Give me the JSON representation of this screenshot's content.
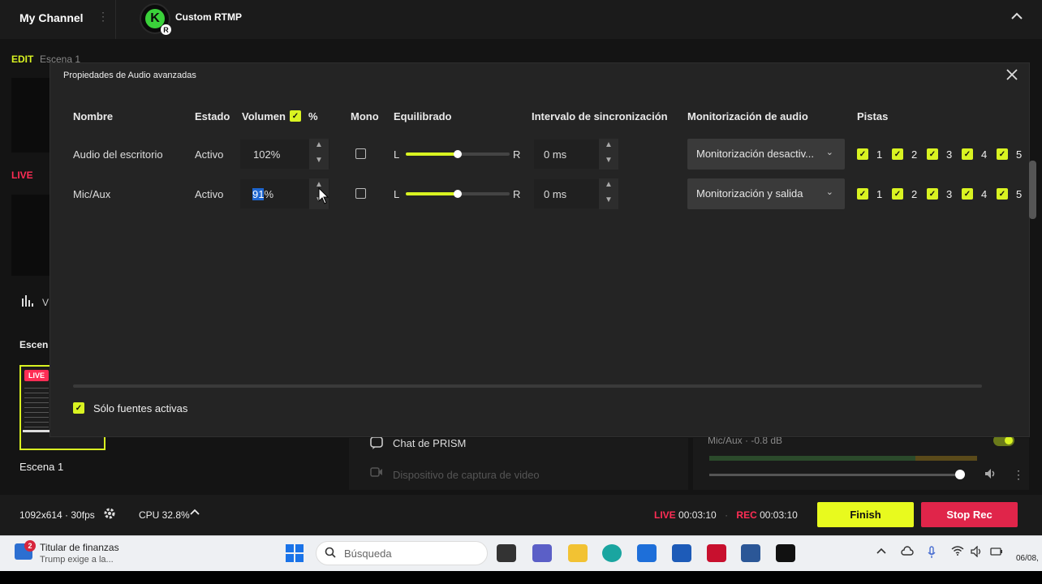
{
  "topbar": {
    "channel": "My Channel",
    "kebab": "⋮",
    "rtmp": "Custom RTMP",
    "collapse": "^",
    "logo_k": "K",
    "logo_r": "R"
  },
  "background": {
    "edit_label": "EDIT",
    "edit_scene": "Escena 1",
    "live_label": "LIVE",
    "bars_text": "V",
    "escenas_head": "Escen",
    "scene_tag": "LIVE",
    "scene_name": "Escena 1",
    "chat_text": "Chat de PRISM",
    "camera_text": "Dispositivo de captura de video",
    "mic_row": "Mic/Aux · -0.8 dB"
  },
  "statusbar": {
    "resolution": "1092x614 · 30fps",
    "cpu": "CPU 32.8%",
    "live_label": "LIVE",
    "live_time": "00:03:10",
    "rec_label": "REC",
    "rec_time": "00:03:10",
    "finish": "Finish",
    "stop_rec": "Stop Rec"
  },
  "dialog": {
    "title": "Propiedades de Audio avanzadas",
    "headers": {
      "name": "Nombre",
      "state": "Estado",
      "volume": "Volumen",
      "percent": "%",
      "mono": "Mono",
      "balance": "Equilibrado",
      "sync": "Intervalo de sincronización",
      "monitoring": "Monitorización de audio",
      "tracks": "Pistas"
    },
    "balance_left": "L",
    "balance_right": "R",
    "rows": [
      {
        "name": "Audio del escritorio",
        "state": "Activo",
        "volume": "102%",
        "balance": 0.5,
        "sync": "0 ms",
        "monitoring": "Monitorización desactiv...",
        "mono": false
      },
      {
        "name": "Mic/Aux",
        "state": "Activo",
        "volume_sel": "91",
        "volume_rest": "%",
        "balance": 0.5,
        "sync": "0 ms",
        "monitoring": "Monitorización y salida",
        "mono": false
      }
    ],
    "tracks": [
      "1",
      "2",
      "3",
      "4",
      "5"
    ],
    "only_active": "Sólo fuentes activas"
  },
  "taskbar": {
    "news_badge": "2",
    "news_title": "Titular de finanzas",
    "news_sub": "Trump exige a la...",
    "search_placeholder": "Búsqueda",
    "date": "06/08,"
  },
  "colors": {
    "accent": "#d9f321",
    "live": "#ff2d55",
    "stop_rec": "#e0254a",
    "finish": "#e8fa1e"
  }
}
